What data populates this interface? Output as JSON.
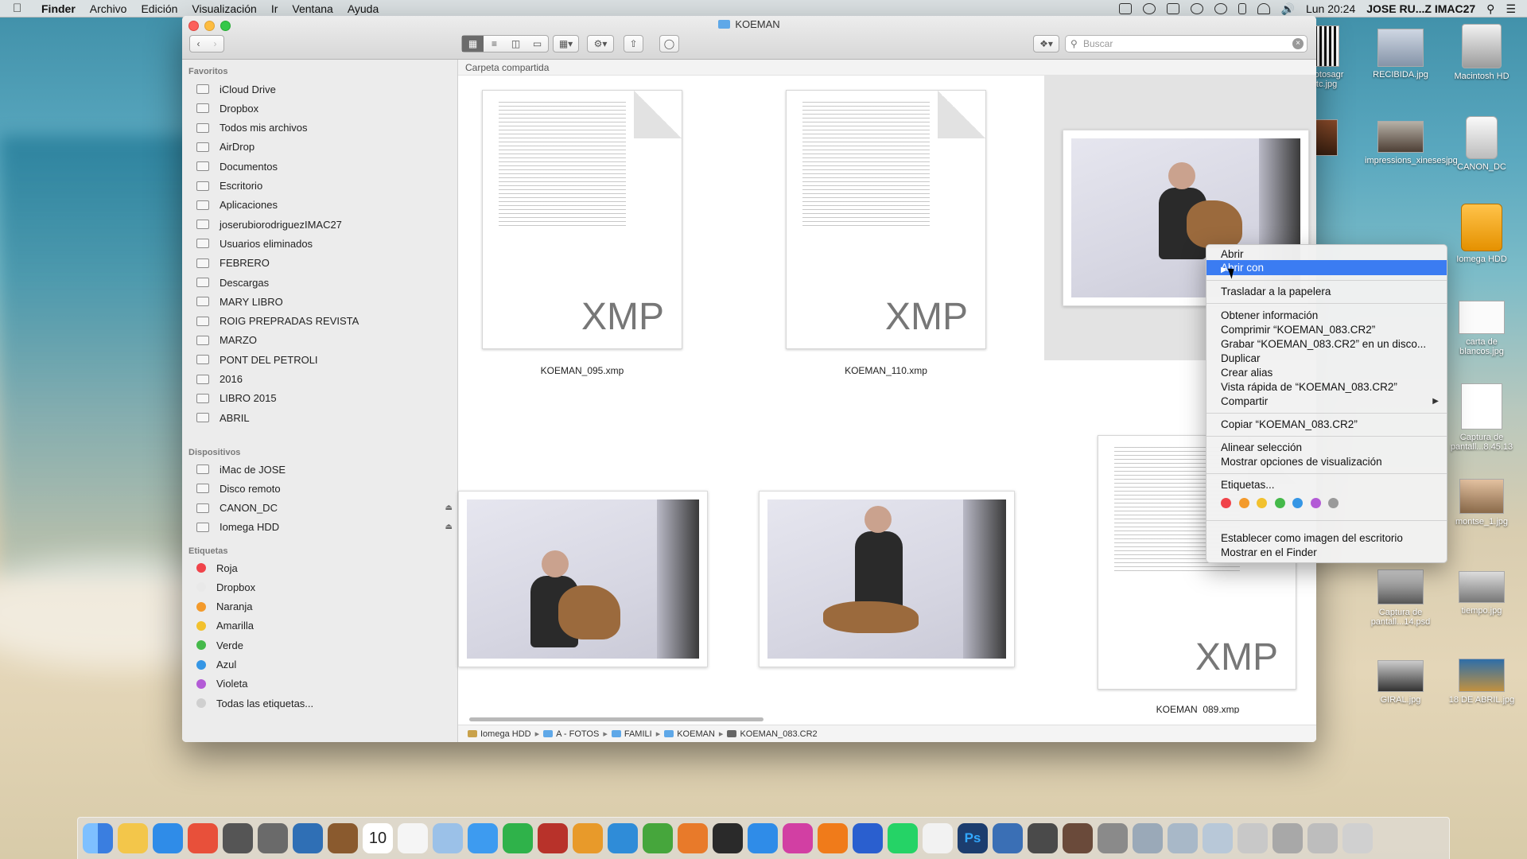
{
  "menubar": {
    "app": "Finder",
    "items": [
      "Archivo",
      "Edición",
      "Visualización",
      "Ir",
      "Ventana",
      "Ayuda"
    ],
    "clock": "Lun 20:24",
    "user": "JOSE RU...Z IMAC27"
  },
  "window": {
    "title": "KOEMAN",
    "search_placeholder": "Buscar",
    "path_label": "Carpeta compartida"
  },
  "sidebar": {
    "favorites_header": "Favoritos",
    "favorites": [
      "iCloud Drive",
      "Dropbox",
      "Todos mis archivos",
      "AirDrop",
      "Documentos",
      "Escritorio",
      "Aplicaciones",
      "joserubiorodriguezIMAC27",
      "Usuarios eliminados",
      "FEBRERO",
      "Descargas",
      "MARY LIBRO",
      "ROIG PREPRADAS REVISTA",
      "MARZO",
      "PONT DEL PETROLI",
      "2016",
      "LIBRO 2015",
      "ABRIL"
    ],
    "devices_header": "Dispositivos",
    "devices": [
      "iMac de JOSE",
      "Disco remoto",
      "CANON_DC",
      "Iomega HDD"
    ],
    "tags_header": "Etiquetas",
    "tags": [
      {
        "label": "Roja",
        "color": "#f0434a"
      },
      {
        "label": "Dropbox",
        "color": "#e9e9e9"
      },
      {
        "label": "Naranja",
        "color": "#f39a2b"
      },
      {
        "label": "Amarilla",
        "color": "#f2c12e"
      },
      {
        "label": "Verde",
        "color": "#45b94a"
      },
      {
        "label": "Azul",
        "color": "#3596e5"
      },
      {
        "label": "Violeta",
        "color": "#b35bd6"
      },
      {
        "label": "Todas las etiquetas...",
        "color": "#cfcfcf"
      }
    ]
  },
  "files": {
    "f1": "KOEMAN_095.xmp",
    "f2": "KOEMAN_110.xmp",
    "f3": "KOEMAN_089.xmp",
    "xmp_label": "XMP"
  },
  "breadcrumb": [
    "Iomega HDD",
    "A - FOTOS",
    "FAMILI",
    "KOEMAN",
    "KOEMAN_083.CR2"
  ],
  "context_menu": {
    "open": "Abrir",
    "open_with": "Abrir con",
    "trash": "Trasladar a la papelera",
    "get_info": "Obtener información",
    "compress": "Comprimir “KOEMAN_083.CR2”",
    "burn": "Grabar “KOEMAN_083.CR2” en un disco...",
    "duplicate": "Duplicar",
    "alias": "Crear alias",
    "quicklook": "Vista rápida de “KOEMAN_083.CR2”",
    "share": "Compartir",
    "copy": "Copiar “KOEMAN_083.CR2”",
    "align": "Alinear selección",
    "view_options": "Mostrar opciones de visualización",
    "tags": "Etiquetas...",
    "tag_colors": [
      "#f0434a",
      "#f39a2b",
      "#f2c12e",
      "#45b94a",
      "#3596e5",
      "#b35bd6",
      "#9a9a9a"
    ],
    "set_desktop": "Establecer como imagen del escritorio",
    "show_finder": "Mostrar en el Finder"
  },
  "desktop": {
    "recibida": "RECIBIDA.jpg",
    "mac_hd": "Macintosh HD",
    "impressions": "impressions_xinesesjpg",
    "canon": "CANON_DC",
    "iomega": "Iomega HDD",
    "carta": "carta de blancos.jpg",
    "captura1": "Captura de pantall...8.45.13",
    "montse": "montse_1.jpg",
    "captura2": "Captura de pantall...14.psd",
    "tiempo": "tiempo.jpg",
    "giral": "GIRAL.jpg",
    "abril": "18 DE ABRIL.jpg",
    "photosagr": "photosagr otc.jpg"
  },
  "dock": {
    "calendar_day": "10"
  }
}
